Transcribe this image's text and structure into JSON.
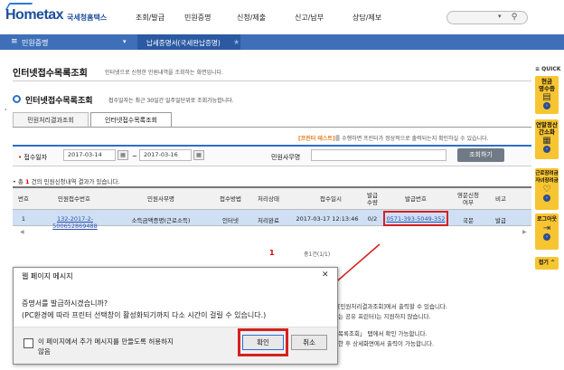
{
  "header": {
    "logo_main": "Hometax",
    "logo_sub": "국세청홈택스",
    "nav": [
      "조회/발급",
      "민원증명",
      "신청/제출",
      "신고/납부",
      "상담/제보"
    ],
    "search_placeholder": ""
  },
  "menubar": {
    "menu_label": "민원증명",
    "breadcrumb": "납세증명서(국세완납증명)"
  },
  "page": {
    "title": "인터넷접수목록조회",
    "description": "인터넷으로 신청한 민원내역을 조회하는 화면입니다.",
    "section_title": "인터넷접수목록조회",
    "section_desc": "접수일자는 최근 30일간 일주일단위로 조회가능합니다.",
    "tabs": [
      "민원처리결과조회",
      "인터넷접수목록조회"
    ],
    "active_tab": 1,
    "notice_highlight": "[프린터 테스트]",
    "notice_rest": "를 수행하면 프린터가 정상적으로 출력되는지 확인하실 수 있습니다."
  },
  "filter": {
    "date_label": "접수일자",
    "date_from": "2017-03-14",
    "date_sep": "~",
    "date_to": "2017-03-16",
    "civil_type_label": "민원사무명",
    "civil_type_value": "",
    "query_button": "조회하기"
  },
  "result": {
    "prefix": "총",
    "count": "1",
    "suffix": "건의 민원신청내역 결과가 있습니다."
  },
  "table": {
    "headers": [
      "번호",
      "민원접수번호",
      "민원사무명",
      "접수방법",
      "처리상태",
      "접수일시",
      "발급\n수량",
      "발급번호",
      "영문신청\n여부",
      "비고"
    ],
    "rows": [
      [
        "1",
        "132-2017-2-500652869488",
        "소득금액증명(근로소득)",
        "인터넷",
        "처리완료",
        "2017-03-17 12:13:46",
        "0/2",
        "0571-393-5049-352",
        "국문",
        "발급"
      ]
    ]
  },
  "pager": {
    "current": "1",
    "info": "총1건(1/1)"
  },
  "background_notes": [
    "[민원처리결과조회]에서 출력할 수 있습니다.",
    "는 공유 프린터)는 지원하지 않습니다.",
    "목록조회」 탭에서 확인 가능합니다.",
    "한 후 상세화면에서 출력이 가능합니다."
  ],
  "sidebar": {
    "head": "≡ QUICK",
    "items": [
      {
        "label": "현금\n영수증",
        "icon": "receipt-icon"
      },
      {
        "label": "연말정산\n간소화",
        "icon": "document-icon"
      },
      {
        "label": "근로장려금\n자녀장려금",
        "icon": "heart-icon"
      },
      {
        "label": "로그아웃",
        "icon": "logout-icon"
      }
    ],
    "fold": "접기"
  },
  "dialog": {
    "title": "웹 페이지 메시지",
    "close": "✕",
    "message_line1": "증명서를 발급하시겠습니까?",
    "message_line2": "(PC환경에 따라 프린터 선택창이 활성화되기까지 다소 시간이 걸릴 수 있습니다.)",
    "checkbox_label_line1": "이 페이지에서 추가 메시지를 만들도록 허용하지",
    "checkbox_label_line2": "않음",
    "ok": "확인",
    "cancel": "취소"
  },
  "colors": {
    "brand": "#1d4f9c",
    "menubar": "#3f6fb8",
    "highlight_red": "#d62020",
    "row_selected": "#cfe0f5",
    "quick_yellow": "#f7c531"
  }
}
